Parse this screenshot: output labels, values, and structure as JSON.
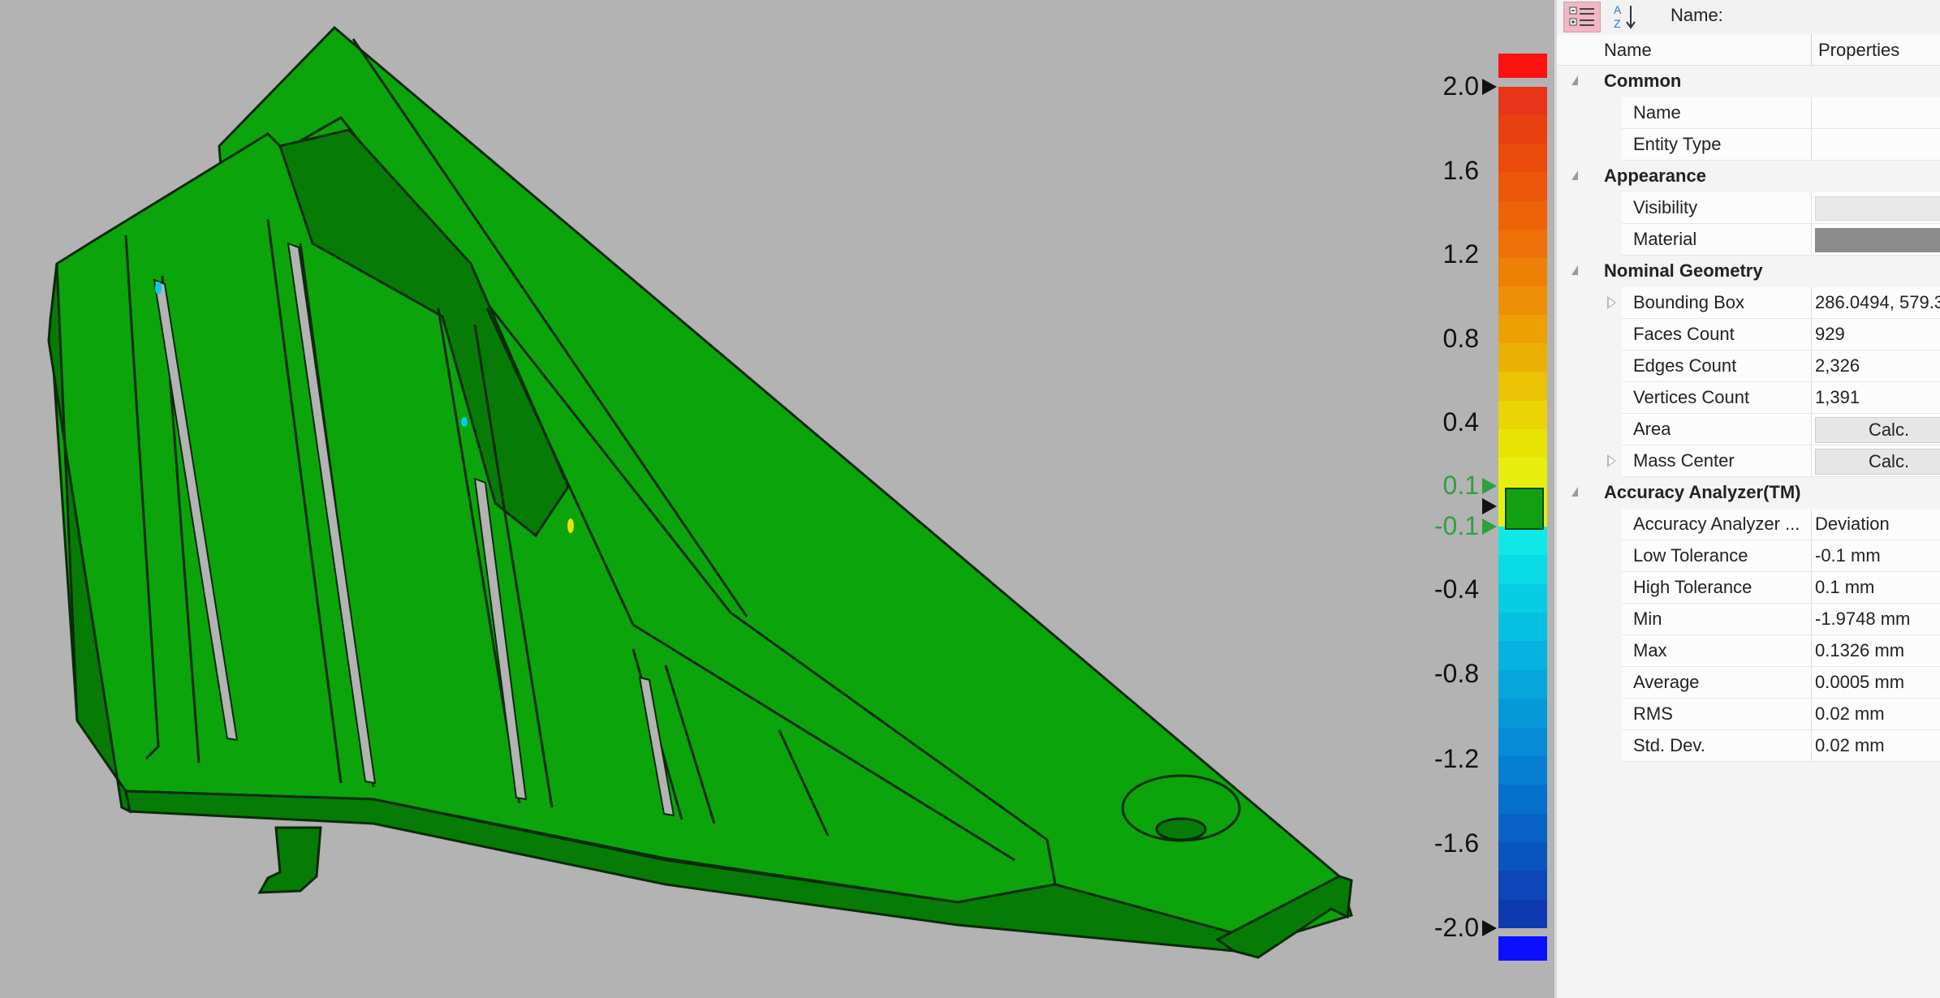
{
  "colors": {
    "part_fill": "#0ba40b",
    "part_dark": "#067c06",
    "edge": "#0a2a0a",
    "background": "#b3b3b3",
    "material_swatch": "#8c8c8c"
  },
  "scale": {
    "labels": [
      {
        "text": "2.0",
        "value": 2.0,
        "tol": false
      },
      {
        "text": "1.6",
        "value": 1.6,
        "tol": false
      },
      {
        "text": "1.2",
        "value": 1.2,
        "tol": false
      },
      {
        "text": "0.8",
        "value": 0.8,
        "tol": false
      },
      {
        "text": "0.4",
        "value": 0.4,
        "tol": false
      },
      {
        "text": "0.1",
        "value": 0.1,
        "tol": true
      },
      {
        "text": "-0.1",
        "value": -0.1,
        "tol": true
      },
      {
        "text": "-0.4",
        "value": -0.4,
        "tol": false
      },
      {
        "text": "-0.8",
        "value": -0.8,
        "tol": false
      },
      {
        "text": "-1.2",
        "value": -1.2,
        "tol": false
      },
      {
        "text": "-1.6",
        "value": -1.6,
        "tol": false
      },
      {
        "text": "-2.0",
        "value": -2.0,
        "tol": false
      }
    ],
    "max": 2.0,
    "min": -2.0,
    "low_tolerance": -0.1,
    "high_tolerance": 0.1,
    "over_color": "#ff1010",
    "under_color": "#0a10ff",
    "nominal_color": "#13a013",
    "warm_colors": [
      "#e83418",
      "#e8400f",
      "#ea4a0c",
      "#ec560a",
      "#ee6208",
      "#ef7006",
      "#ef8006",
      "#ee9005",
      "#eda004",
      "#ecb004",
      "#ebc204",
      "#ead404",
      "#e9e304",
      "#e8ee10"
    ],
    "cool_colors": [
      "#10e8e8",
      "#08dbe6",
      "#06cde4",
      "#06c0e2",
      "#06b3e0",
      "#06a6dd",
      "#0699da",
      "#068cd6",
      "#067fd2",
      "#0670cd",
      "#0862c6",
      "#0a54bf",
      "#0c46b8",
      "#0e3aaf"
    ]
  },
  "toolbar": {
    "categorized_icon": "categorized-icon",
    "sort_az_icon": "sort-az-icon",
    "name_label": "Name:"
  },
  "columns": {
    "name": "Name",
    "properties": "Properties"
  },
  "rows": [
    {
      "type": "cat",
      "name": "Common"
    },
    {
      "type": "prop",
      "name": "Name",
      "value": ""
    },
    {
      "type": "prop",
      "name": "Entity Type",
      "value": ""
    },
    {
      "type": "cat",
      "name": "Appearance"
    },
    {
      "type": "prop",
      "name": "Visibility",
      "kind": "visibility"
    },
    {
      "type": "prop",
      "name": "Material",
      "kind": "swatch"
    },
    {
      "type": "cat",
      "name": "Nominal Geometry"
    },
    {
      "type": "prop",
      "name": "Bounding Box",
      "value": "286.0494, 579.3",
      "expand": true
    },
    {
      "type": "prop",
      "name": "Faces Count",
      "value": "929"
    },
    {
      "type": "prop",
      "name": "Edges Count",
      "value": "2,326"
    },
    {
      "type": "prop",
      "name": "Vertices Count",
      "value": "1,391"
    },
    {
      "type": "prop",
      "name": "Area",
      "kind": "calc",
      "value": "Calc."
    },
    {
      "type": "prop",
      "name": "Mass Center",
      "kind": "calc",
      "value": "Calc.",
      "expand": true
    },
    {
      "type": "cat",
      "name": "Accuracy Analyzer(TM)"
    },
    {
      "type": "prop",
      "name": "Accuracy Analyzer ...",
      "value": "Deviation"
    },
    {
      "type": "prop",
      "name": "Low Tolerance",
      "value": "-0.1 mm"
    },
    {
      "type": "prop",
      "name": "High Tolerance",
      "value": "0.1 mm"
    },
    {
      "type": "prop",
      "name": "Min",
      "value": "-1.9748 mm"
    },
    {
      "type": "prop",
      "name": "Max",
      "value": "0.1326 mm"
    },
    {
      "type": "prop",
      "name": "Average",
      "value": "0.0005 mm"
    },
    {
      "type": "prop",
      "name": "RMS",
      "value": "0.02 mm"
    },
    {
      "type": "prop",
      "name": "Std. Dev.",
      "value": "0.02 mm"
    }
  ]
}
